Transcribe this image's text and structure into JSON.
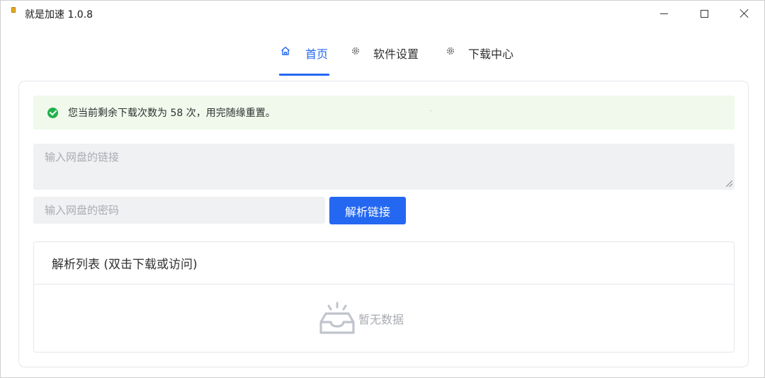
{
  "window": {
    "title": "就是加速  1.0.8"
  },
  "nav": {
    "tabs": [
      {
        "label": "首页",
        "icon": "home-icon",
        "active": true
      },
      {
        "label": "软件设置",
        "icon": "gear-icon",
        "active": false
      },
      {
        "label": "下载中心",
        "icon": "gear-icon",
        "active": false
      }
    ]
  },
  "alert": {
    "text": "您当前剩余下载次数为 58 次，用完随缘重置。",
    "icon": "success-check-icon",
    "color": "#22b14c"
  },
  "form": {
    "link_placeholder": "输入网盘的链接",
    "password_placeholder": "输入网盘的密码",
    "parse_button": "解析链接"
  },
  "list": {
    "title": "解析列表 (双击下载或访问)",
    "empty_text": "暂无数据",
    "empty_icon": "empty-inbox-icon"
  },
  "colors": {
    "accent": "#2468f2",
    "alert_bg": "#f0f9eb",
    "input_bg": "#f0f1f3"
  }
}
